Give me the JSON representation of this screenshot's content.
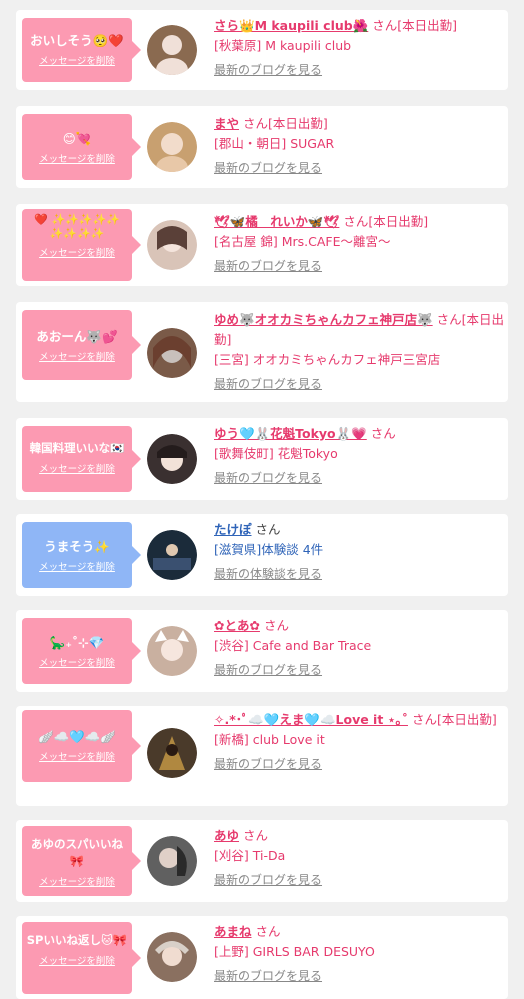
{
  "delete_label": "メッセージを削除",
  "entries": [
    {
      "message": "おいしそう🥺❤️",
      "name": "さら👑M kaupili club🌺",
      "suffix": "さん[本日出勤]",
      "shop": "[秋葉原] M kaupili club",
      "link": "最新のブログを見る",
      "color": "pink"
    },
    {
      "message": "😊💘",
      "name": "まや",
      "suffix": "さん[本日出勤]",
      "shop": "[郡山・朝日] SUGAR",
      "link": "最新のブログを見る",
      "color": "pink"
    },
    {
      "message": "❤️ ✨✨✨✨✨ ✨✨✨✨",
      "name": "🕊🦋橘　れいか🦋🕊",
      "suffix": "さん[本日出勤]",
      "shop": "[名古屋 錦] Mrs.CAFE〜離宮〜",
      "link": "最新のブログを見る",
      "color": "pink"
    },
    {
      "message": "あおーん🐺💕",
      "name": "ゆめ🐺オオカミちゃんカフェ神戸店🐺",
      "suffix": "さん[本日出勤]",
      "shop": "[三宮] オオカミちゃんカフェ神戸三宮店",
      "link": "最新のブログを見る",
      "color": "pink"
    },
    {
      "message": "韓国料理いいな🇰🇷",
      "name": "ゆう🩵🐰花魁Tokyo🐰💗",
      "suffix": "さん",
      "shop": "[歌舞伎町] 花魁Tokyo",
      "link": "最新のブログを見る",
      "color": "pink"
    },
    {
      "message": "うまそう✨",
      "name": "たけぽ",
      "suffix": "さん",
      "shop": "[滋賀県]体験談 4件",
      "link": "最新の体験談を見る",
      "color": "blue"
    },
    {
      "message": "🦕₊˚⊹💎",
      "name": "✿とあ✿",
      "suffix": "さん",
      "shop": "[渋谷] Cafe and Bar Trace",
      "link": "最新のブログを見る",
      "color": "pink"
    },
    {
      "message": "🪽☁️🩵☁️🪽",
      "name": "✧.*･ﾟ☁️🩵えま🩵☁️Love it ⋆｡˚",
      "suffix": "さん[本日出勤]",
      "shop": "[新橋] club Love it",
      "link": "最新のブログを見る",
      "color": "pink"
    },
    {
      "message": "あゆのスパいいね🎀",
      "name": "あゆ",
      "suffix": "さん",
      "shop": "[刈谷] Ti-Da",
      "link": "最新のブログを見る",
      "color": "pink"
    },
    {
      "message": "SPいいね返し🐱🎀",
      "name": "あまね",
      "suffix": "さん",
      "shop": "[上野] GIRLS BAR DESUYO",
      "link": "最新のブログを見る",
      "color": "pink"
    }
  ],
  "avatar_colors": [
    "#8a6a50",
    "#c8a070",
    "#d9c4b8",
    "#7a5a48",
    "#3a3030",
    "#1b2b3a",
    "#c9b0a0",
    "#4a3a2a",
    "#606060",
    "#8a7060"
  ]
}
